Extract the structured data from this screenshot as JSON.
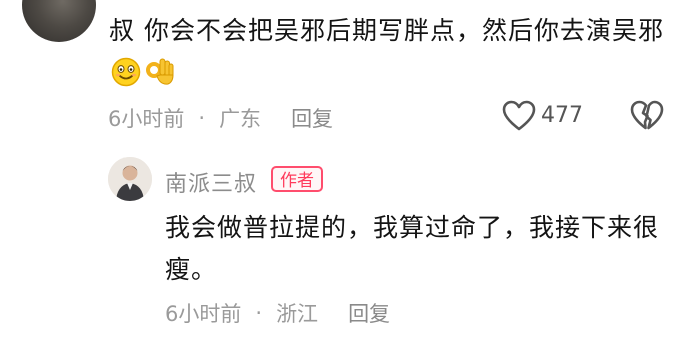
{
  "comment": {
    "text": "叔 你会不会把吴邪后期写胖点，然后你去演吴邪",
    "emojis": [
      "smiling-face-icon",
      "ok-hand-icon"
    ],
    "time": "6小时前",
    "separator": "·",
    "location": "广东",
    "reply_label": "回复",
    "like_count": "477"
  },
  "reply": {
    "author": "南派三叔",
    "badge": "作者",
    "badge_color": "#ff3b5c",
    "text": "我会做普拉提的，我算过命了，我接下来很瘦。",
    "time": "6小时前",
    "separator": "·",
    "location": "浙江",
    "reply_label": "回复"
  }
}
